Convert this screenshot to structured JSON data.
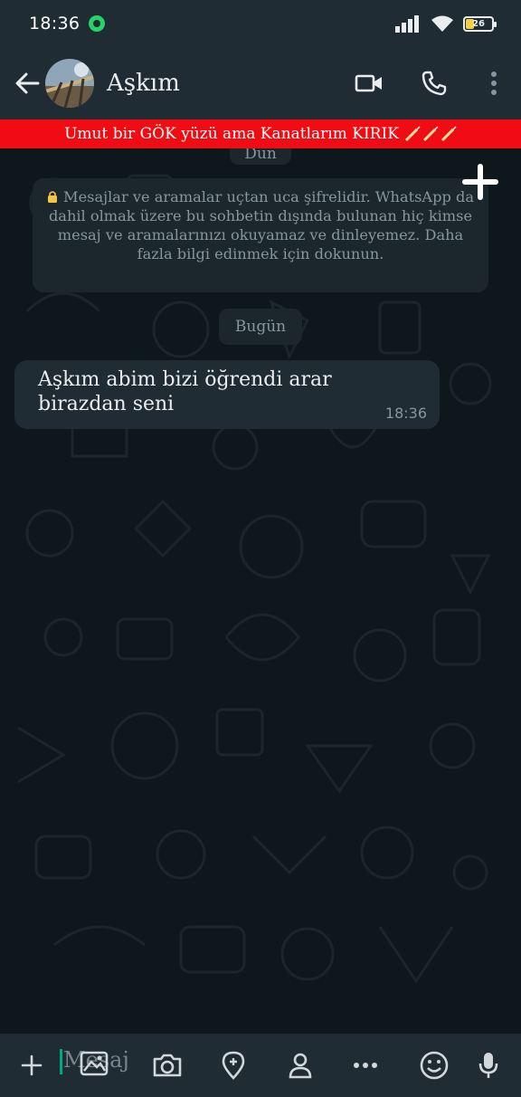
{
  "status_bar": {
    "time": "18:36",
    "battery": "26"
  },
  "header": {
    "contact_name": "Aşkım"
  },
  "banner": {
    "text": "Umut bir GÖK yüzü ama Kanatlarım KIRIK"
  },
  "chat": {
    "top_date_chip": "Dün",
    "encryption_notice": "Mesajlar ve aramalar uçtan uca şifrelidir. WhatsApp da dahil olmak üzere bu sohbetin dışında bulunan hiç kimse mesaj ve aramalarınızı okuyamaz ve dinleyemez. Daha fazla bilgi edinmek için dokunun.",
    "today_chip": "Bugün",
    "messages": [
      {
        "text": "Aşkım abim bizi öğrendi arar birazdan seni",
        "time": "18:36"
      }
    ]
  },
  "input": {
    "placeholder": "Mesaj"
  },
  "colors": {
    "accent": "#00a884",
    "banner": "#f10b12",
    "bubble": "#1f2c33",
    "bar": "#1f2c33"
  },
  "icons": [
    "back-arrow-icon",
    "video-call-icon",
    "phone-icon",
    "more-vert-icon",
    "lock-icon",
    "plus-icon",
    "gallery-icon",
    "camera-icon",
    "location-icon",
    "contact-icon",
    "more-horiz-icon",
    "emoji-icon",
    "mic-icon"
  ]
}
